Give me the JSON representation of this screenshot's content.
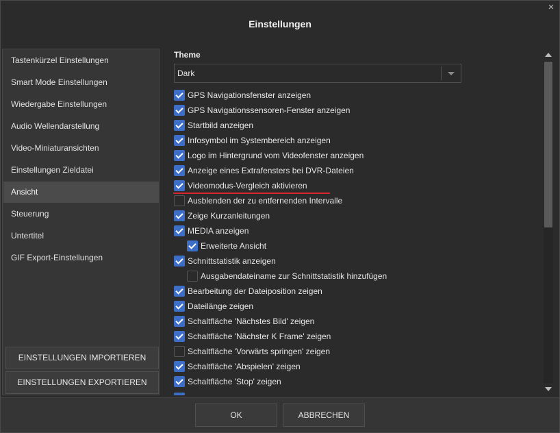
{
  "dialog": {
    "title": "Einstellungen",
    "close_glyph": "×"
  },
  "sidebar": {
    "items": [
      {
        "label": "Tastenkürzel Einstellungen",
        "active": false
      },
      {
        "label": "Smart Mode Einstellungen",
        "active": false
      },
      {
        "label": "Wiedergabe Einstellungen",
        "active": false
      },
      {
        "label": "Audio Wellendarstellung",
        "active": false
      },
      {
        "label": "Video-Miniaturansichten",
        "active": false
      },
      {
        "label": "Einstellungen Zieldatei",
        "active": false
      },
      {
        "label": "Ansicht",
        "active": true
      },
      {
        "label": "Steuerung",
        "active": false
      },
      {
        "label": "Untertitel",
        "active": false
      },
      {
        "label": "GIF Export-Einstellungen",
        "active": false
      }
    ],
    "import_button": "EINSTELLUNGEN IMPORTIEREN",
    "export_button": "EINSTELLUNGEN EXPORTIEREN"
  },
  "theme": {
    "label": "Theme",
    "value": "Dark"
  },
  "options": [
    {
      "label": "GPS Navigationsfenster anzeigen",
      "checked": true,
      "indent": 0
    },
    {
      "label": "GPS Navigationssensoren-Fenster anzeigen",
      "checked": true,
      "indent": 0
    },
    {
      "label": "Startbild anzeigen",
      "checked": true,
      "indent": 0
    },
    {
      "label": "Infosymbol im Systembereich anzeigen",
      "checked": true,
      "indent": 0
    },
    {
      "label": "Logo im Hintergrund vom Videofenster anzeigen",
      "checked": true,
      "indent": 0
    },
    {
      "label": "Anzeige eines Extrafensters bei DVR-Dateien",
      "checked": true,
      "indent": 0
    },
    {
      "label": "Videomodus-Vergleich aktivieren",
      "checked": true,
      "indent": 0
    },
    {
      "label": "Ausblenden der zu entfernenden Intervalle",
      "checked": false,
      "indent": 0
    },
    {
      "label": "Zeige Kurzanleitungen",
      "checked": true,
      "indent": 0
    },
    {
      "label": "MEDIA anzeigen",
      "checked": true,
      "indent": 0
    },
    {
      "label": "Erweiterte Ansicht",
      "checked": true,
      "indent": 1
    },
    {
      "label": "Schnittstatistik anzeigen",
      "checked": true,
      "indent": 0
    },
    {
      "label": "Ausgabendateiname zur Schnittstatistik hinzufügen",
      "checked": false,
      "indent": 1
    },
    {
      "label": "Bearbeitung der Dateiposition zeigen",
      "checked": true,
      "indent": 0
    },
    {
      "label": "Dateilänge zeigen",
      "checked": true,
      "indent": 0
    },
    {
      "label": "Schaltfläche 'Nächstes Bild' zeigen",
      "checked": true,
      "indent": 0
    },
    {
      "label": "Schaltfläche 'Nächster K Frame' zeigen",
      "checked": true,
      "indent": 0
    },
    {
      "label": "Schaltfläche 'Vorwärts springen' zeigen",
      "checked": false,
      "indent": 0
    },
    {
      "label": "Schaltfläche 'Abspielen' zeigen",
      "checked": true,
      "indent": 0
    },
    {
      "label": "Schaltfläche 'Stop' zeigen",
      "checked": true,
      "indent": 0
    }
  ],
  "footer": {
    "ok_label": "OK",
    "cancel_label": "ABBRECHEN"
  },
  "colors": {
    "accent": "#3d6fc8",
    "highlight": "#d8262b"
  }
}
